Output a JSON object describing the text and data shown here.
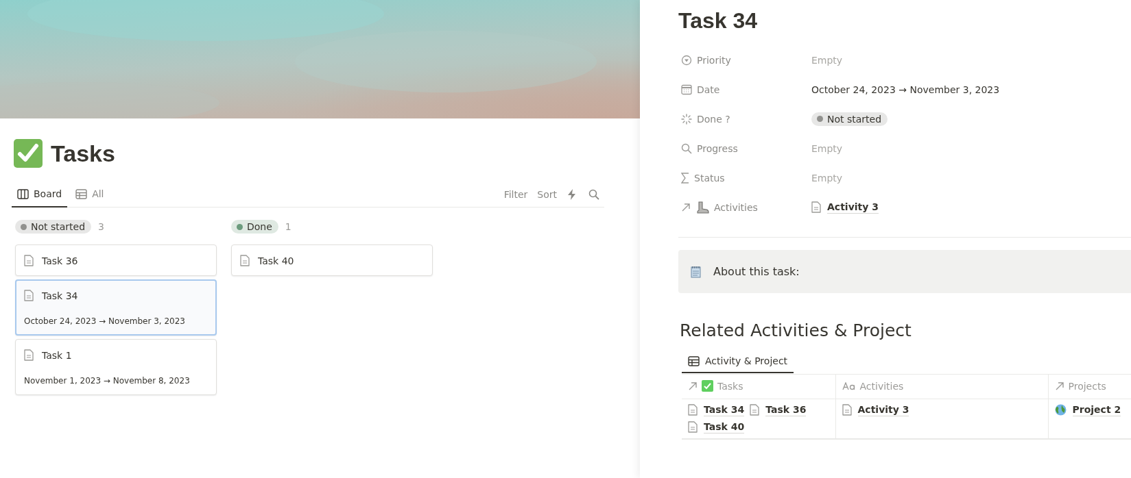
{
  "page": {
    "title": "Tasks"
  },
  "views": [
    {
      "label": "Board",
      "kind": "board",
      "selected": true
    },
    {
      "label": "All",
      "kind": "table",
      "selected": false
    }
  ],
  "toolbar": [
    "Filter",
    "Sort"
  ],
  "groups": [
    {
      "label": "Not started",
      "count": "3",
      "color": "#91918e",
      "cards": [
        {
          "title": "Task 36",
          "selected": false
        },
        {
          "title": "Task 34",
          "date": "October 24, 2023 → November 3, 2023",
          "selected": true
        },
        {
          "title": "Task 1",
          "date": "November 1, 2023 → November 8, 2023",
          "selected": false
        }
      ]
    },
    {
      "label": "Done",
      "count": "1",
      "color": "#6c9b7d",
      "cards": [
        {
          "title": "Task 40",
          "selected": false
        }
      ]
    }
  ],
  "detail": {
    "title": "Task 34",
    "properties": [
      {
        "label": "Priority",
        "kind": "select",
        "placeholder": "Empty"
      },
      {
        "label": "Date",
        "kind": "date",
        "value": "October 24, 2023 → November 3, 2023"
      },
      {
        "label": "Done ?",
        "kind": "status",
        "value": "Not started",
        "color": "#91918e"
      },
      {
        "label": "Progress",
        "kind": "lookup",
        "placeholder": "Empty"
      },
      {
        "label": "Status",
        "kind": "formula",
        "placeholder": "Empty"
      },
      {
        "label": "Activities",
        "kind": "relation",
        "value": "Activity 3"
      }
    ],
    "callout": "About this task:",
    "heading": "Related Activities & Project",
    "view_tab": {
      "label": "Activity & Project",
      "selected": true
    },
    "columns": [
      {
        "label": "Tasks",
        "kind": "relation"
      },
      {
        "label": "Activities",
        "kind": "title"
      },
      {
        "label": "Projects",
        "kind": "relation"
      }
    ],
    "rows": [
      {
        "cells": [
          {
            "kind": "page",
            "items": [
              "Task 34",
              "Task 36",
              "Task 40"
            ]
          },
          {
            "kind": "page",
            "items": [
              "Activity 3"
            ]
          },
          {
            "kind": "globe",
            "items": [
              "Project 2"
            ]
          }
        ]
      }
    ]
  }
}
